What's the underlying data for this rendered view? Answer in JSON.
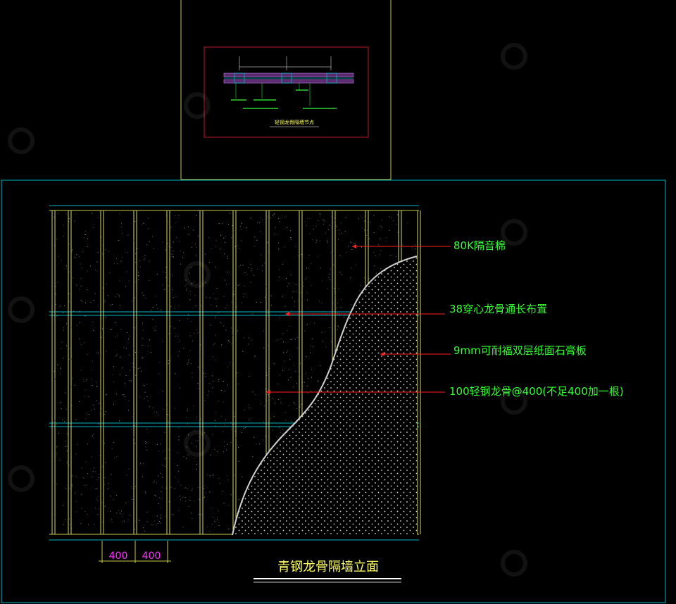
{
  "elevation": {
    "title": "青钢龙骨隔墙立面",
    "annotations": [
      {
        "id": "sound-insulation",
        "text": "80K隔音棉"
      },
      {
        "id": "through-keel",
        "text": "38穿心龙骨通长布置"
      },
      {
        "id": "gypsum-board",
        "text": "9mm可耐福双层纸面石膏板"
      },
      {
        "id": "steel-stud",
        "text": "100轻钢龙骨@400(不足400加一根)"
      }
    ],
    "dimensions": [
      "400",
      "400"
    ]
  },
  "detail": {
    "title": "轻钢龙骨隔墙节点"
  },
  "colors": {
    "background": "#000000",
    "frame_cyan": "#00b7c3",
    "frame_yellow": "#c8c84a",
    "stud_yellow": "#d8d86a",
    "leader_red": "#ff2020",
    "label_green": "#33ff33",
    "dimension_magenta": "#ff33ff",
    "title_yellow": "#ffff66",
    "detail_border": "#c0192a",
    "board_outline": "#cfcfcf"
  },
  "icons": {
    "watermark": "ouyuan-watermark-icon"
  }
}
